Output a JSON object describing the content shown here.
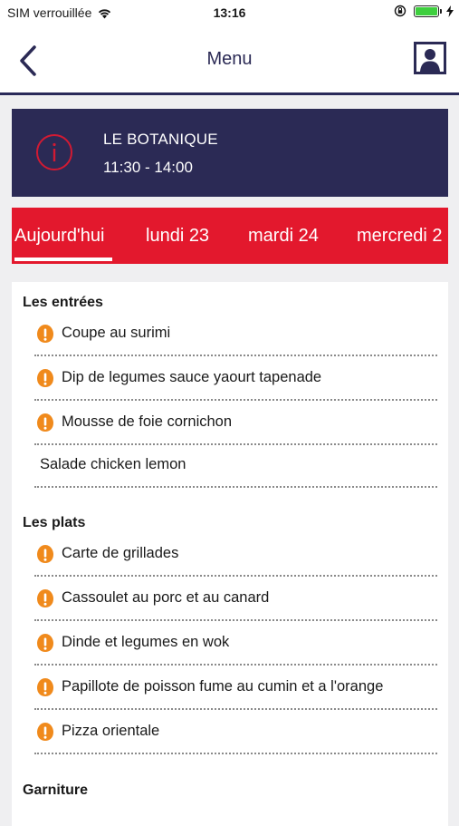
{
  "status_bar": {
    "carrier": "SIM verrouillée",
    "time": "13:16"
  },
  "nav": {
    "title": "Menu"
  },
  "restaurant": {
    "name": "LE BOTANIQUE",
    "hours": "11:30 - 14:00"
  },
  "tabs": [
    {
      "label": "Aujourd'hui",
      "active": true
    },
    {
      "label": "lundi 23"
    },
    {
      "label": "mardi 24"
    },
    {
      "label": "mercredi 2"
    }
  ],
  "sections": [
    {
      "title": "Les entrées",
      "items": [
        {
          "label": "Coupe au surimi",
          "icon": "allergen-warning-icon"
        },
        {
          "label": "Dip de legumes sauce yaourt tapenade",
          "icon": "allergen-warning-icon"
        },
        {
          "label": "Mousse de foie cornichon",
          "icon": "allergen-warning-icon"
        },
        {
          "label": "Salade chicken lemon"
        }
      ]
    },
    {
      "title": "Les plats",
      "items": [
        {
          "label": "Carte de grillades",
          "icon": "allergen-warning-icon"
        },
        {
          "label": "Cassoulet au porc et au canard",
          "icon": "allergen-warning-icon"
        },
        {
          "label": "Dinde et legumes en wok",
          "icon": "allergen-warning-icon"
        },
        {
          "label": "Papillote de poisson fume au cumin et a l'orange",
          "icon": "allergen-warning-icon"
        },
        {
          "label": "Pizza orientale",
          "icon": "allergen-warning-icon"
        }
      ]
    },
    {
      "title": "Garniture",
      "items": []
    }
  ],
  "colors": {
    "navy": "#2b2a55",
    "red": "#e3182d",
    "warning": "#f08a1c",
    "background": "#efeff1"
  }
}
